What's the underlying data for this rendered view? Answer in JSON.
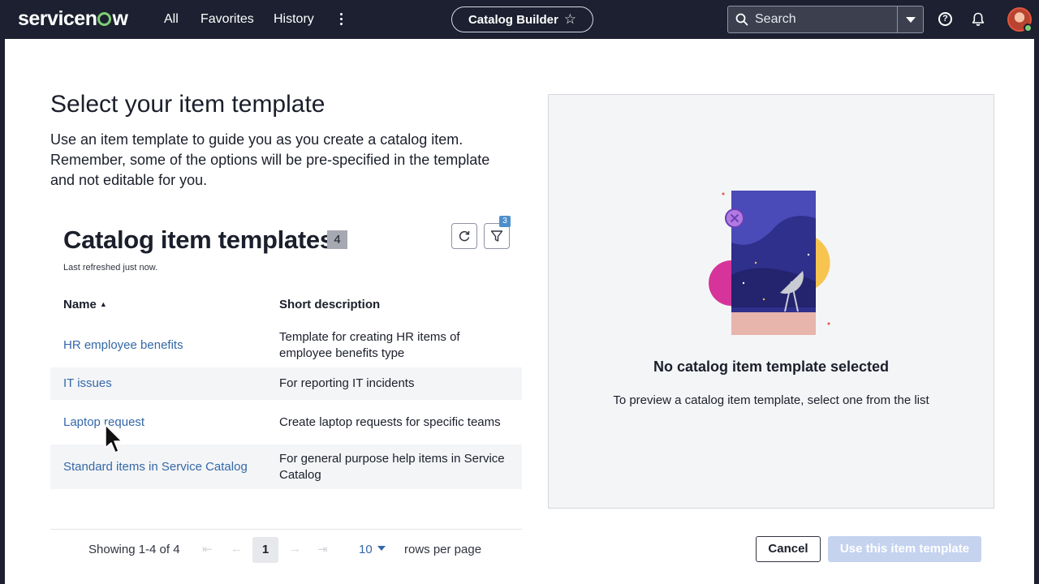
{
  "header": {
    "logo": "servicenow",
    "nav": [
      "All",
      "Favorites",
      "History"
    ],
    "context_title": "Catalog Builder",
    "search_placeholder": "Search",
    "icons": [
      "search-icon",
      "help-icon",
      "bell-icon",
      "avatar"
    ]
  },
  "page": {
    "title": "Select your item template",
    "description": "Use an item template to guide you as you create a catalog item. Remember, some of the options will be pre-specified in the template and not editable for you."
  },
  "list": {
    "title": "Catalog item templates",
    "count": "4",
    "last_refreshed": "Last refreshed just now.",
    "filter_count": "3",
    "columns": [
      "Name",
      "Short description"
    ],
    "rows": [
      {
        "name": "HR employee benefits",
        "description": "Template for creating HR items of employee benefits type"
      },
      {
        "name": "IT issues",
        "description": "For reporting IT incidents"
      },
      {
        "name": "Laptop request",
        "description": "Create laptop requests for specific teams"
      },
      {
        "name": "Standard items in Service Catalog",
        "description": "For general purpose help items in Service Catalog"
      }
    ]
  },
  "pagination": {
    "showing": "Showing 1-4 of 4",
    "current_page": "1",
    "rows_per_page_value": "10",
    "rows_per_page_label": "rows per page"
  },
  "preview": {
    "title": "No catalog item template selected",
    "description": "To preview a catalog item template, select one from the list"
  },
  "actions": {
    "cancel": "Cancel",
    "use_template": "Use this item template"
  },
  "colors": {
    "nav_bg": "#1c2030",
    "link": "#3468a8",
    "disabled_button": "#c5d3ef",
    "brand_green": "#7fce73"
  }
}
